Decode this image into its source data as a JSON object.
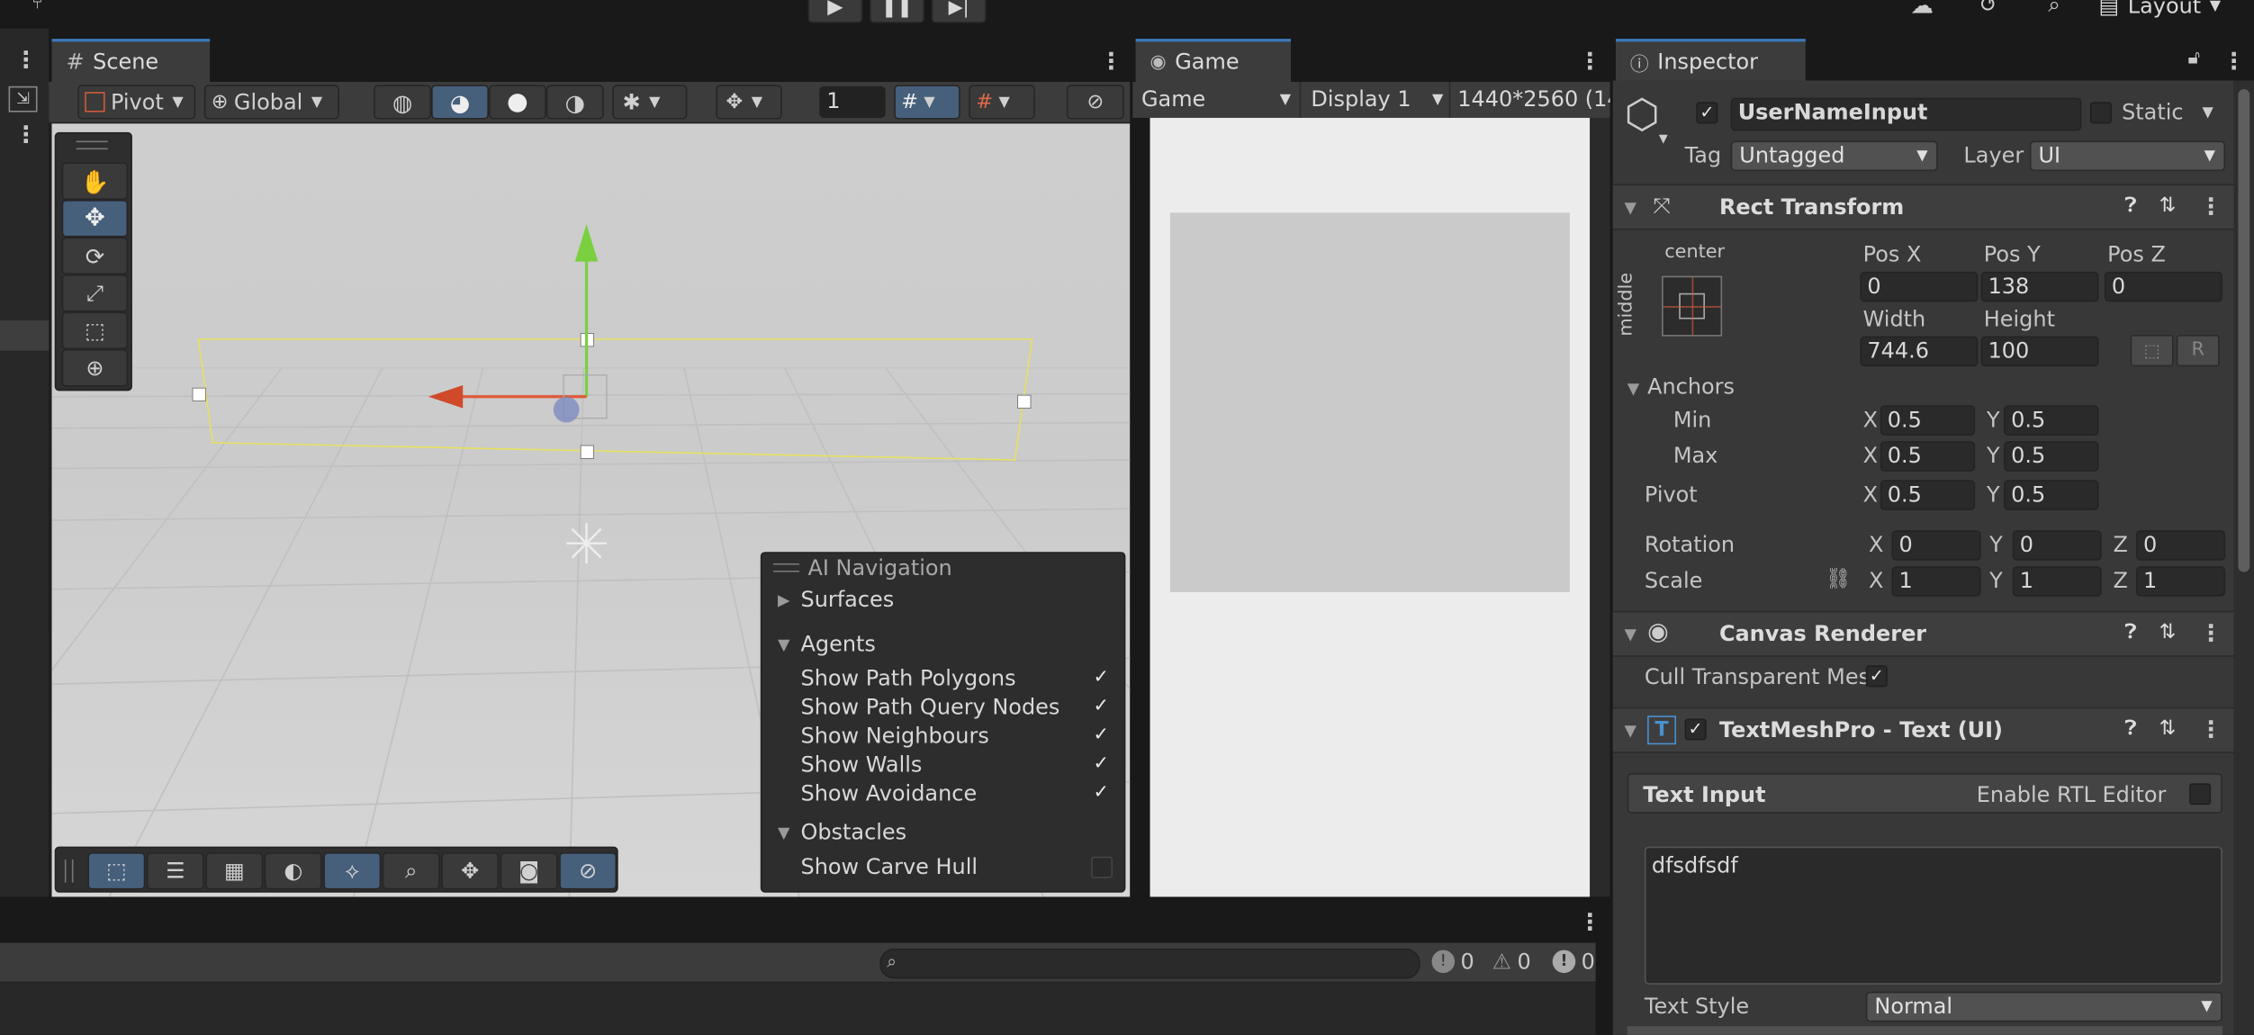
{
  "topbar": {
    "layout_label": "Layout"
  },
  "scene_panel": {
    "tab_label": "Scene",
    "pivot_label": "Pivot",
    "global_label": "Global",
    "grid_snap_value": "1"
  },
  "game_panel": {
    "tab_label": "Game",
    "mode_dropdown": "Game",
    "display_dropdown": "Display 1",
    "resolution": "1440*2560 (14"
  },
  "ai_navigation": {
    "title": "AI Navigation",
    "surfaces": "Surfaces",
    "agents": "Agents",
    "items": [
      {
        "label": "Show Path Polygons",
        "checked": true
      },
      {
        "label": "Show Path Query Nodes",
        "checked": true
      },
      {
        "label": "Show Neighbours",
        "checked": true
      },
      {
        "label": "Show Walls",
        "checked": true
      },
      {
        "label": "Show Avoidance",
        "checked": true
      }
    ],
    "obstacles": "Obstacles",
    "carve_hull": {
      "label": "Show Carve Hull",
      "checked": false
    }
  },
  "console": {
    "count_info": "0",
    "count_warn": "0",
    "count_error": "0"
  },
  "inspector": {
    "tab_label": "Inspector",
    "object_name": "UserNameInput",
    "static_label": "Static",
    "tag_label": "Tag",
    "tag_value": "Untagged",
    "layer_label": "Layer",
    "layer_value": "UI",
    "rect_transform": {
      "title": "Rect Transform",
      "anchor_h": "center",
      "anchor_v": "middle",
      "pos_x_label": "Pos X",
      "pos_x": "0",
      "pos_y_label": "Pos Y",
      "pos_y": "138",
      "pos_z_label": "Pos Z",
      "pos_z": "0",
      "width_label": "Width",
      "width": "744.6",
      "height_label": "Height",
      "height": "100",
      "r_button": "R",
      "anchors_label": "Anchors",
      "min_label": "Min",
      "min_x": "0.5",
      "min_y": "0.5",
      "max_label": "Max",
      "max_x": "0.5",
      "max_y": "0.5",
      "pivot_label": "Pivot",
      "pivot_x": "0.5",
      "pivot_y": "0.5",
      "rotation_label": "Rotation",
      "rot_x": "0",
      "rot_y": "0",
      "rot_z": "0",
      "scale_label": "Scale",
      "scale_x": "1",
      "scale_y": "1",
      "scale_z": "1",
      "x": "X",
      "y": "Y",
      "z": "Z"
    },
    "canvas_renderer": {
      "title": "Canvas Renderer",
      "cull_label": "Cull Transparent Mes"
    },
    "textmeshpro": {
      "title": "TextMeshPro - Text (UI)",
      "text_input_label": "Text Input",
      "rtl_label": "Enable RTL Editor",
      "text_value": "dfsdfsdf",
      "text_style_label": "Text Style",
      "text_style_value": "Normal"
    }
  },
  "colors": {
    "accent": "#3a79bb",
    "panel": "#383838",
    "selected_tool": "#46607c"
  }
}
